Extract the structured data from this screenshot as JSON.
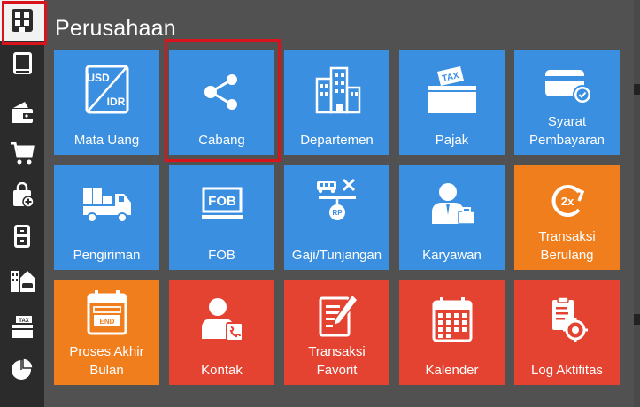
{
  "page": {
    "title": "Perusahaan"
  },
  "sidebar": {
    "items": [
      {
        "icon": "building-grid-icon",
        "active": true
      },
      {
        "icon": "book-icon"
      },
      {
        "icon": "wallet-icon"
      },
      {
        "icon": "shopping-cart-icon"
      },
      {
        "icon": "shopping-bag-icon"
      },
      {
        "icon": "file-cabinet-icon"
      },
      {
        "icon": "office-building-icon"
      },
      {
        "icon": "tax-ticket-icon"
      },
      {
        "icon": "pie-chart-icon"
      }
    ]
  },
  "tiles": {
    "mata_uang": {
      "label": "Mata Uang",
      "icon": "currency-exchange-icon",
      "color": "#3a8fe0",
      "usd": "USD",
      "idr": "IDR"
    },
    "cabang": {
      "label": "Cabang",
      "icon": "branch-share-icon",
      "color": "#3a8fe0"
    },
    "departemen": {
      "label": "Departemen",
      "icon": "buildings-icon",
      "color": "#3a8fe0"
    },
    "pajak": {
      "label": "Pajak",
      "icon": "tax-icon",
      "color": "#3a8fe0",
      "tax": "TAX"
    },
    "syarat_pembayaran": {
      "label": "Syarat\nPembayaran",
      "icon": "payment-card-icon",
      "color": "#3a8fe0"
    },
    "pengiriman": {
      "label": "Pengiriman",
      "icon": "delivery-truck-icon",
      "color": "#3a8fe0"
    },
    "fob": {
      "label": "FOB",
      "icon": "fob-icon",
      "color": "#3a8fe0",
      "fob": "FOB"
    },
    "gaji": {
      "label": "Gaji/Tunjangan",
      "icon": "salary-scale-icon",
      "color": "#3a8fe0",
      "rp": "RP"
    },
    "karyawan": {
      "label": "Karyawan",
      "icon": "employee-icon",
      "color": "#3a8fe0"
    },
    "transaksi_berulang": {
      "label": "Transaksi\nBerulang",
      "icon": "recurring-2x-icon",
      "color": "#f07e1d",
      "badge": "2x"
    },
    "proses_akhir_bulan": {
      "label": "Proses Akhir\nBulan",
      "icon": "month-end-calendar-icon",
      "color": "#f07e1d",
      "end": "END"
    },
    "kontak": {
      "label": "Kontak",
      "icon": "contact-icon",
      "color": "#e34330"
    },
    "transaksi_favorit": {
      "label": "Transaksi\nFavorit",
      "icon": "favorite-document-icon",
      "color": "#e34330"
    },
    "kalender": {
      "label": "Kalender",
      "icon": "calendar-icon",
      "color": "#e34330"
    },
    "log_aktifitas": {
      "label": "Log Aktifitas",
      "icon": "activity-log-icon",
      "color": "#e34330"
    }
  }
}
